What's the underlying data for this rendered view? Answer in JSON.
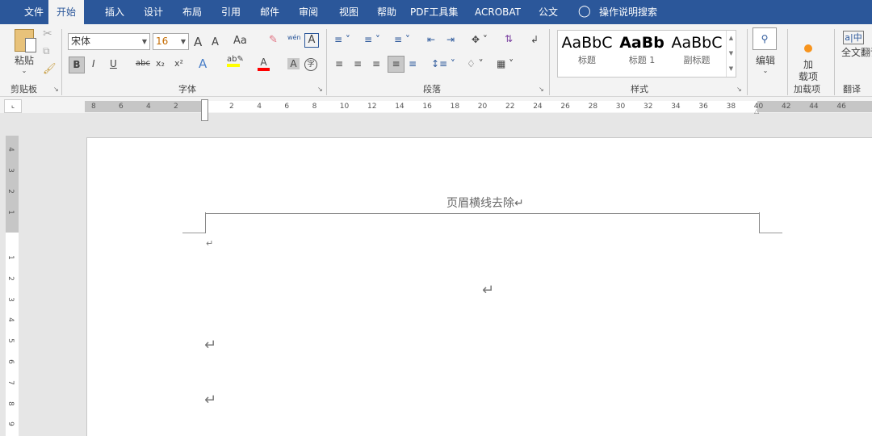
{
  "tabs": [
    "文件",
    "开始",
    "插入",
    "设计",
    "布局",
    "引用",
    "邮件",
    "审阅",
    "视图",
    "帮助",
    "PDF工具集",
    "ACROBAT",
    "公文"
  ],
  "active_tab": "开始",
  "tell_me": "操作说明搜索",
  "clipboard": {
    "paste": "粘贴",
    "label": "剪贴板"
  },
  "font": {
    "name": "宋体",
    "size": "16",
    "label": "字体",
    "bold": "B",
    "italic": "I",
    "underline": "U",
    "strike": "abc",
    "sub": "x₂",
    "sup": "x²",
    "grow": "A",
    "shrink": "A",
    "case": "Aa",
    "phonetic": "wén",
    "border": "A",
    "color_a": "A",
    "shade_a": "A",
    "enclose": "字",
    "highlight_color": "#ffff00",
    "font_color": "#ff0000"
  },
  "paragraph": {
    "label": "段落"
  },
  "styles": {
    "label": "样式",
    "items": [
      {
        "preview": "AaBbC",
        "name": "标题"
      },
      {
        "preview": "AaBb",
        "name": "标题 1"
      },
      {
        "preview": "AaBbC",
        "name": "副标题"
      }
    ]
  },
  "editing": {
    "label": "编辑"
  },
  "addins": {
    "button": "加\n载项",
    "label": "加载项"
  },
  "translate": {
    "button": "全文翻译",
    "label": "翻译"
  },
  "ruler": {
    "h_labels": [
      "8",
      "6",
      "4",
      "2",
      "2",
      "4",
      "6",
      "8",
      "10",
      "12",
      "14",
      "16",
      "18",
      "20",
      "22",
      "24",
      "26",
      "28",
      "30",
      "32",
      "34",
      "36",
      "38",
      "40",
      "42",
      "44",
      "46"
    ],
    "v_labels": [
      "4",
      "3",
      "2",
      "1",
      "1",
      "2",
      "3",
      "4",
      "5",
      "6",
      "7",
      "8",
      "9"
    ]
  },
  "document": {
    "header_text": "页眉横线去除↵",
    "return_mark": "↵"
  }
}
